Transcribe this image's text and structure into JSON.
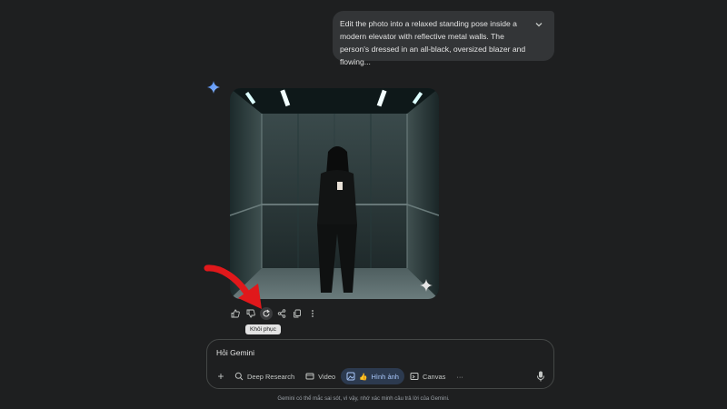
{
  "conversation": {
    "user_prompt": "Edit the photo into a relaxed standing pose inside a modern elevator with reflective metal walls. The person's dressed in an all-black, oversized blazer and flowing..."
  },
  "response": {
    "image_alt": "Woman in oversized black blazer standing in a reflective metal elevator"
  },
  "actions": {
    "tooltip": "Khôi phục"
  },
  "composer": {
    "placeholder": "Hỏi Gemini",
    "tools": [
      {
        "label": "Deep Research",
        "icon": "deep-research-icon"
      },
      {
        "label": "Video",
        "icon": "video-icon"
      },
      {
        "label": "Hình ảnh",
        "icon": "image-icon",
        "emoji": "👍"
      },
      {
        "label": "Canvas",
        "icon": "canvas-icon"
      }
    ]
  },
  "footer": {
    "disclaimer": "Gemini có thể mắc sai sót, vì vậy, nhớ xác minh câu trả lời của Gemini."
  },
  "colors": {
    "accent": "#a8c7fa",
    "background": "#1e1f20",
    "annotation_arrow": "#e0181b"
  }
}
